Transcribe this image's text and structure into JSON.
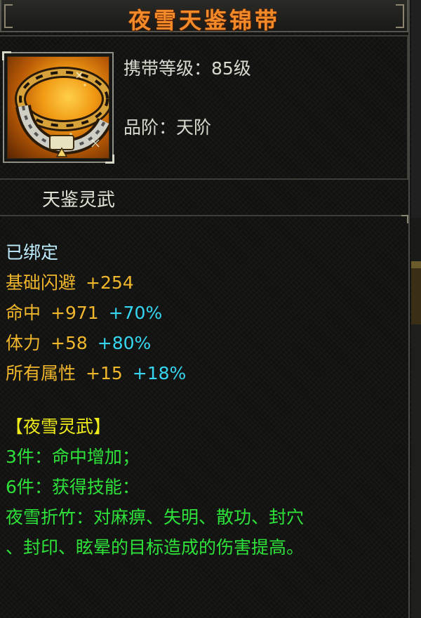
{
  "item": {
    "name": "夜雪天鉴锦带",
    "level_label": "携带等级：85级",
    "grade_label": "品阶：天阶",
    "subtitle": "天鉴灵武",
    "icon": "belt-icon"
  },
  "stats": {
    "bound": "已绑定",
    "attributes": [
      {
        "name": "基础闪避",
        "base": "+254",
        "pct": ""
      },
      {
        "name": "命中",
        "base": "+971",
        "pct": "+70%"
      },
      {
        "name": "体力",
        "base": "+58",
        "pct": "+80%"
      },
      {
        "name": "所有属性",
        "base": "+15",
        "pct": "+18%"
      }
    ]
  },
  "set": {
    "title": "【夜雪灵武】",
    "lines": [
      "3件：命中增加；",
      "6件：获得技能：",
      "夜雪折竹：对麻痹、失明、散功、封穴",
      "、封印、眩晕的目标造成的伤害提高。"
    ]
  },
  "colors": {
    "title": "#f28a2a",
    "attribute": "#f0b62c",
    "percent": "#36d6f0",
    "bound": "#bfeeff",
    "set_title": "#f0ec1c",
    "set_text": "#2ee23a"
  }
}
